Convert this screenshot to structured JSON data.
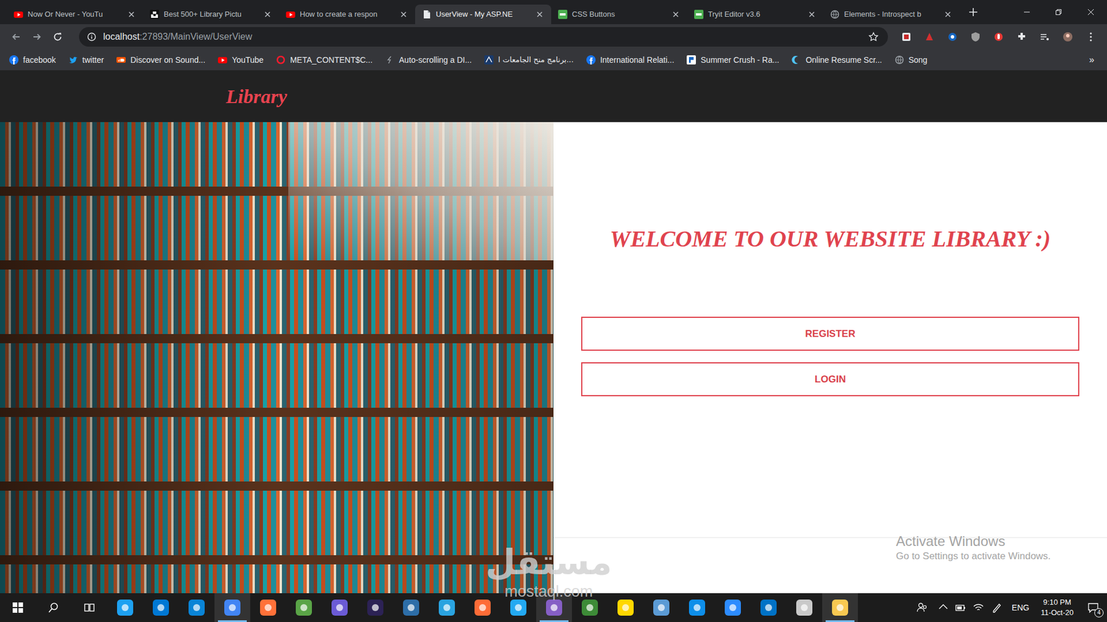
{
  "tabs": [
    {
      "label": "Now Or Never - YouTu",
      "selected": false,
      "kind": "youtube"
    },
    {
      "label": "Best 500+ Library Pictu",
      "selected": false,
      "kind": "unsplash"
    },
    {
      "label": "How to create a respon",
      "selected": false,
      "kind": "youtube"
    },
    {
      "label": "UserView - My ASP.NE",
      "selected": true,
      "kind": "page"
    },
    {
      "label": "CSS Buttons",
      "selected": false,
      "kind": "w3"
    },
    {
      "label": "Tryit Editor v3.6",
      "selected": false,
      "kind": "w3"
    },
    {
      "label": "Elements - Introspect b",
      "selected": false,
      "kind": "globe"
    }
  ],
  "address": {
    "host": "localhost",
    "path": ":27893/MainView/UserView"
  },
  "bookmarks": [
    {
      "label": "facebook",
      "kind": "facebook"
    },
    {
      "label": "twitter",
      "kind": "twitter"
    },
    {
      "label": "Discover on Sound...",
      "kind": "soundcloud"
    },
    {
      "label": "YouTube",
      "kind": "youtube"
    },
    {
      "label": "META_CONTENT$C...",
      "kind": "opera"
    },
    {
      "label": "Auto-scrolling a DI...",
      "kind": "generic"
    },
    {
      "label": "برنامج منح الجامعات ا...",
      "kind": "arabic"
    },
    {
      "label": "International Relati...",
      "kind": "facebook"
    },
    {
      "label": "Summer Crush - Ra...",
      "kind": "r"
    },
    {
      "label": "Online Resume Scr...",
      "kind": "crescent"
    },
    {
      "label": "Song",
      "kind": "globe"
    }
  ],
  "bookmarks_more": "»",
  "page": {
    "logo": "Library",
    "welcome": "WELCOME TO OUR WEBSITE LIBRARY :)",
    "buttons": [
      "REGISTER",
      "LOGIN"
    ]
  },
  "activation": {
    "title": "Activate Windows",
    "subtitle": "Go to Settings to activate Windows."
  },
  "watermark": {
    "arabic": "مستقل",
    "latin": "mostaql.com"
  },
  "taskbar": {
    "apps": [
      {
        "color": "#1ea1f1",
        "running": false
      },
      {
        "color": "#0078d4",
        "running": false
      },
      {
        "color": "#0a84d6",
        "running": false
      },
      {
        "color": "#4285f4",
        "running": true
      },
      {
        "color": "#ff7139",
        "running": false
      },
      {
        "color": "#5aa447",
        "running": false
      },
      {
        "color": "#6b5bd6",
        "running": false
      },
      {
        "color": "#2c2255",
        "running": false
      },
      {
        "color": "#2d6ea8",
        "running": false
      },
      {
        "color": "#2aa3e0",
        "running": false
      },
      {
        "color": "#ff6c37",
        "running": false
      },
      {
        "color": "#23a9f2",
        "running": false
      },
      {
        "color": "#865fc5",
        "running": true
      },
      {
        "color": "#3d8b37",
        "running": false
      },
      {
        "color": "#ffd700",
        "running": false
      },
      {
        "color": "#5b9bd5",
        "running": false
      },
      {
        "color": "#0e8ee9",
        "running": false
      },
      {
        "color": "#2d8cff",
        "running": false
      },
      {
        "color": "#0072c6",
        "running": false
      },
      {
        "color": "#c9c9c9",
        "running": false
      },
      {
        "color": "#f8c851",
        "running": true
      }
    ],
    "language": "ENG",
    "time": "9:10 PM",
    "date": "11-Oct-20",
    "notifications": "4"
  }
}
